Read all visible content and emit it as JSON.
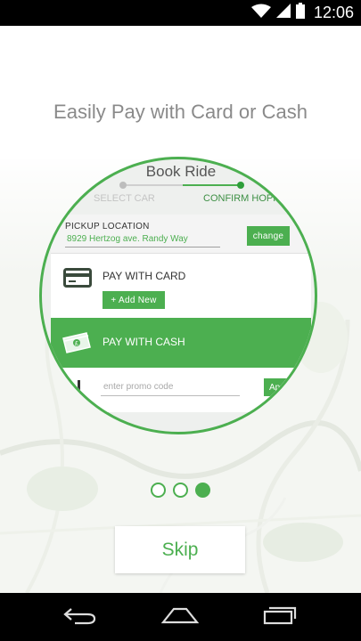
{
  "status_bar": {
    "time": "12:06",
    "icons": [
      "wifi-icon",
      "signal-icon",
      "battery-icon"
    ]
  },
  "onboarding": {
    "headline": "Easily Pay with Card or Cash",
    "pager": {
      "total": 3,
      "active_index": 2
    },
    "skip_label": "Skip"
  },
  "preview": {
    "title": "Book Ride",
    "steps": [
      {
        "label": "SELECT CAR",
        "state": "done"
      },
      {
        "label": "CONFIRM HOPPA",
        "state": "active"
      }
    ],
    "pickup": {
      "label": "PICKUP LOCATION",
      "value": "8929 Hertzog ave. Randy Way",
      "change_label": "change"
    },
    "card": {
      "label": "PAY WITH CARD",
      "add_new_label": "+ Add New",
      "icon": "credit-card-icon"
    },
    "cash": {
      "label": "PAY WITH CASH",
      "icon": "cash-icon"
    },
    "promo": {
      "placeholder": "enter promo code",
      "apply_label": "Ap"
    }
  },
  "colors": {
    "accent": "#4caf50",
    "headline": "#8a8a8a",
    "bars": "#000000"
  },
  "nav_bar": {
    "icons": [
      "back-icon",
      "home-icon",
      "recent-apps-icon"
    ]
  }
}
